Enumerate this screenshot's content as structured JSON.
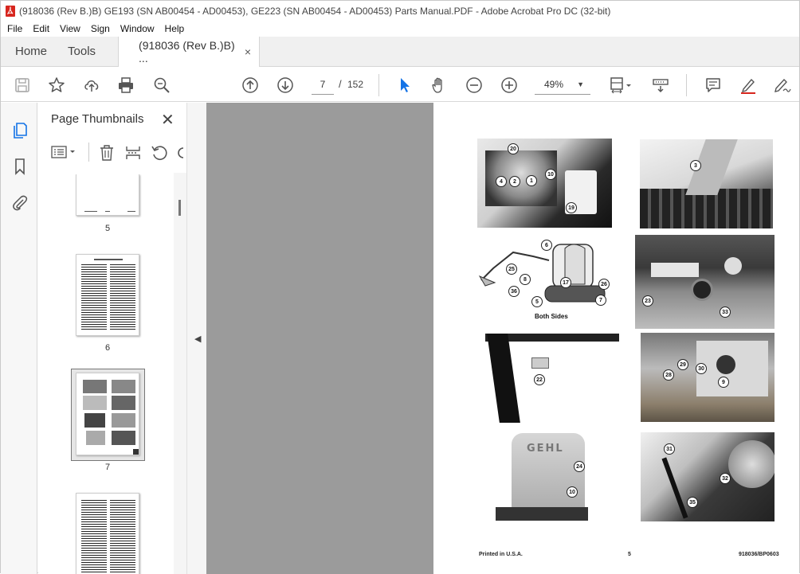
{
  "window": {
    "title": "(918036 (Rev B.)B) GE193 (SN AB00454 - AD00453), GE223 (SN AB00454 - AD00453) Parts Manual.PDF - Adobe Acrobat Pro DC (32-bit)"
  },
  "menu": [
    "File",
    "Edit",
    "View",
    "Sign",
    "Window",
    "Help"
  ],
  "tabs": {
    "home": "Home",
    "tools": "Tools",
    "document": "(918036 (Rev B.)B) ...",
    "close": "×"
  },
  "toolbar": {
    "current_page": "7",
    "page_separator": "/",
    "total_pages": "152",
    "zoom": "49%"
  },
  "thumbnails_panel": {
    "title": "Page Thumbnails",
    "close": "✕",
    "pages": [
      {
        "label": "5"
      },
      {
        "label": "6"
      },
      {
        "label": "7"
      }
    ]
  },
  "page": {
    "callouts": {
      "p1": [
        "20",
        "4",
        "2",
        "1",
        "10",
        "19"
      ],
      "p2": [
        "3"
      ],
      "p3": [
        "6",
        "25",
        "8",
        "17",
        "26",
        "36",
        "5",
        "7"
      ],
      "p4": [
        "23",
        "33"
      ],
      "p5": [
        "22"
      ],
      "p6": [
        "29",
        "30",
        "28",
        "9"
      ],
      "p7": [
        "24",
        "10"
      ],
      "p8": [
        "31",
        "32",
        "35"
      ]
    },
    "caption_both_sides": "Both Sides",
    "brand_logo": "GEHL",
    "footer": {
      "left": "Printed in U.S.A.",
      "center": "5",
      "right": "918036/BP0603"
    }
  },
  "colors": {
    "acrobat_red": "#d7261e",
    "selection_blue": "#1473e6",
    "doc_background": "#9b9b9b"
  }
}
